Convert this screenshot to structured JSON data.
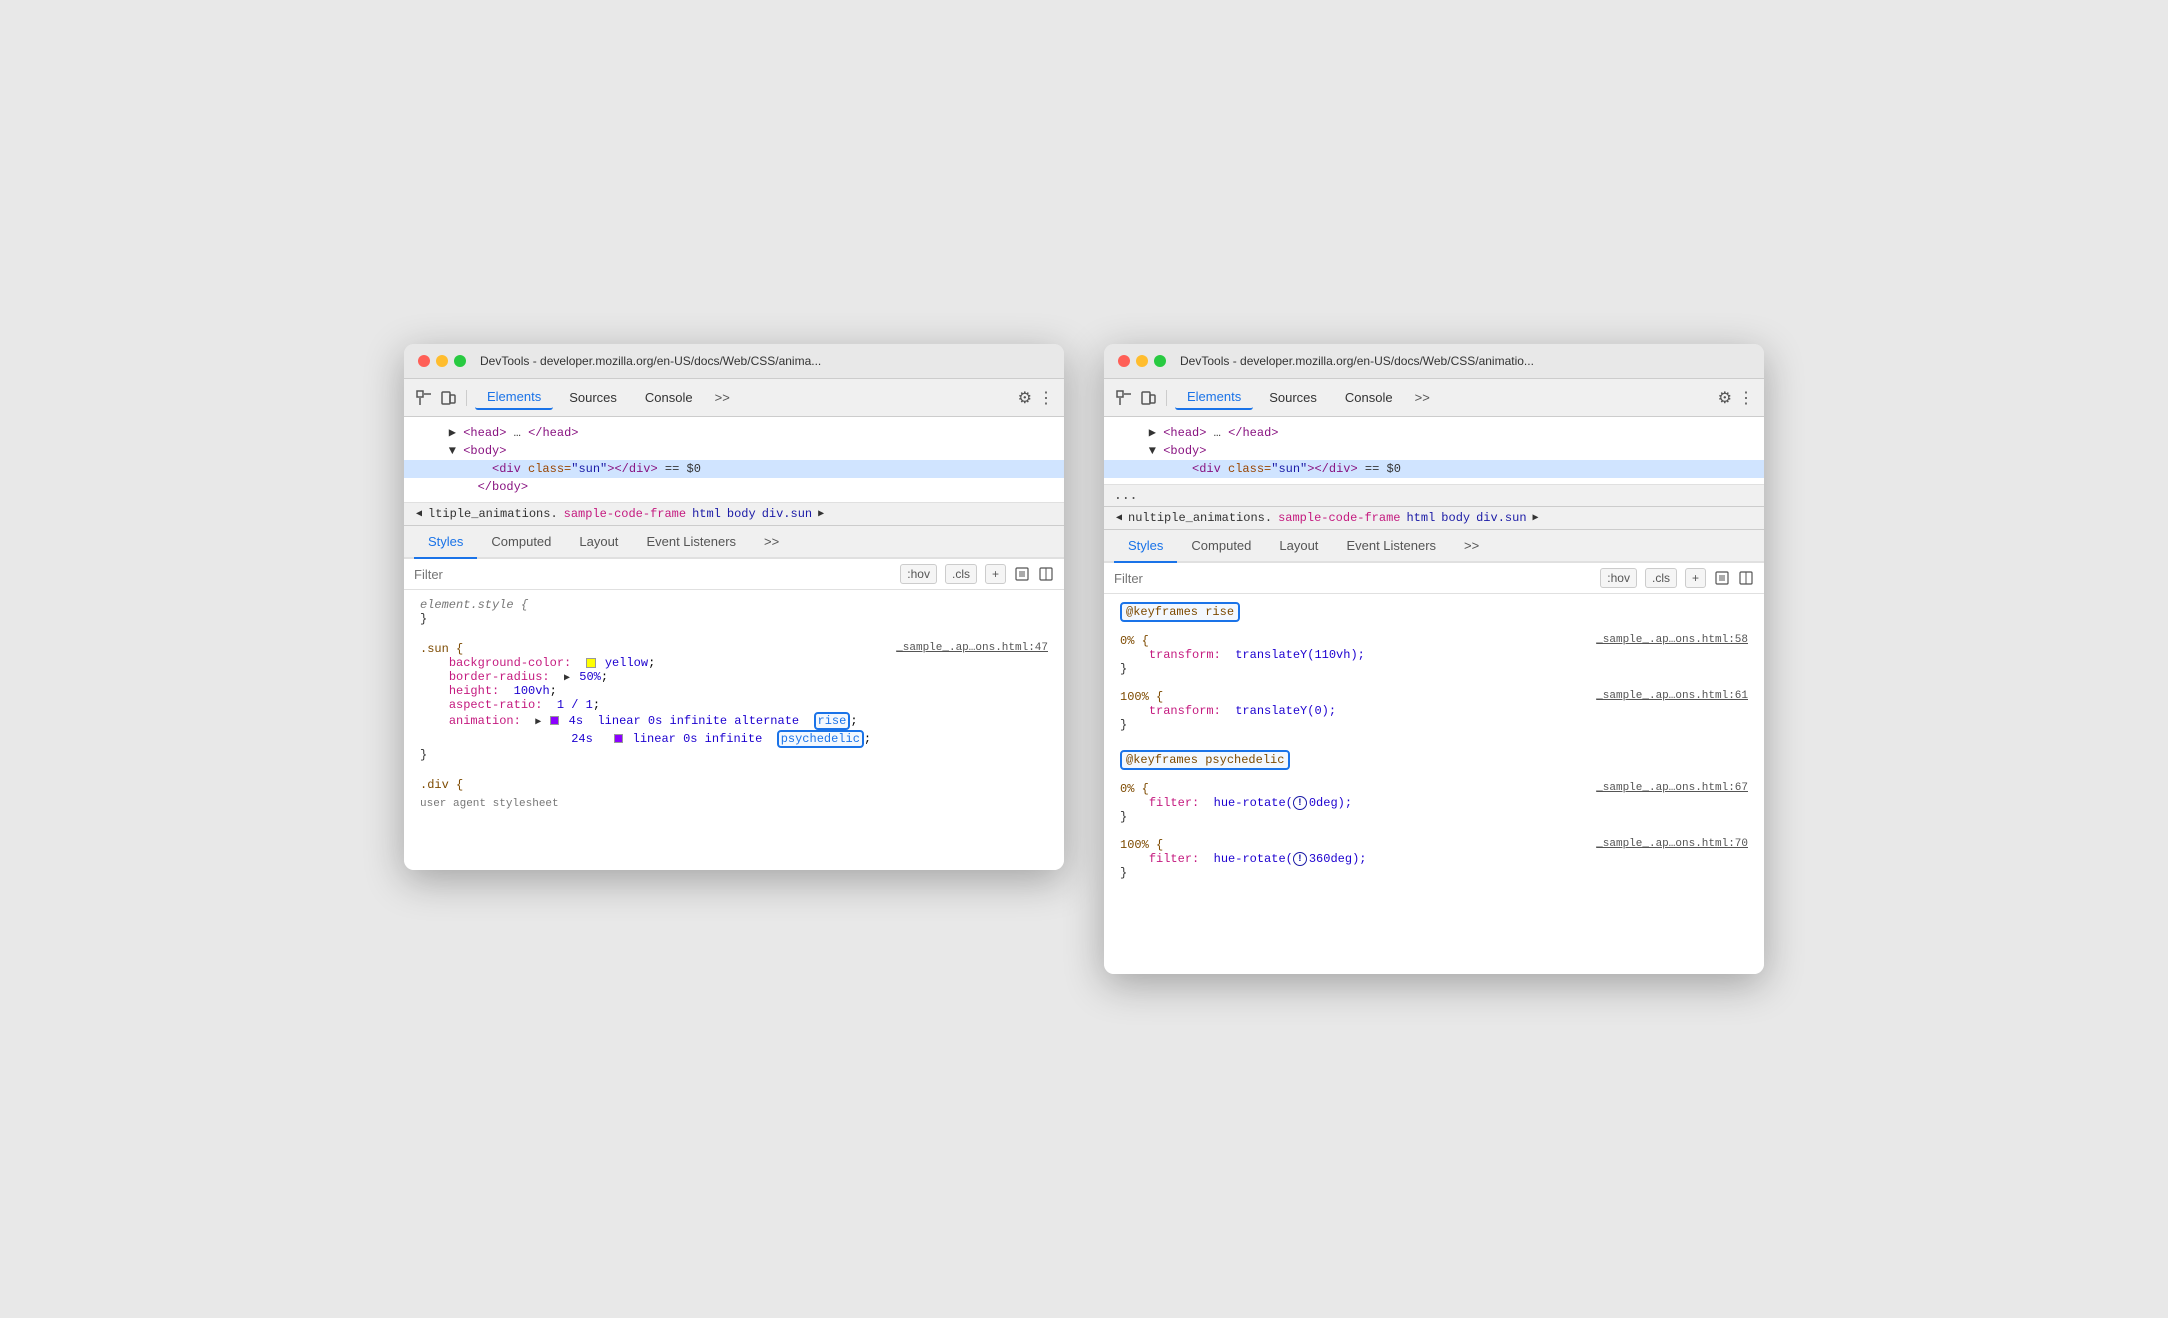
{
  "left_window": {
    "title": "DevTools - developer.mozilla.org/en-US/docs/Web/CSS/anima...",
    "traffic_lights": [
      "red",
      "yellow",
      "green"
    ],
    "toolbar_tabs": [
      "Elements",
      "Sources",
      "Console"
    ],
    "toolbar_more": ">>",
    "dom_lines": [
      "<head> … </head>",
      "<body>",
      "<div class=\"sun\"></div>  == $0",
      "</body>"
    ],
    "breadcrumb": "◀ ltiple_animations.sample-code-frame  html  body  div.sun  ▶",
    "panel_tabs": [
      "Styles",
      "Computed",
      "Layout",
      "Event Listeners",
      ">>"
    ],
    "filter_placeholder": "Filter",
    "filter_btns": [
      ":hov",
      ".cls",
      "+"
    ],
    "css_rules": [
      {
        "selector": "element.style {",
        "close": "}",
        "props": []
      },
      {
        "selector": ".sun {",
        "source": "_sample_.ap…ons.html:47",
        "close": "}",
        "props": [
          {
            "name": "background-color:",
            "value": "yellow",
            "has_swatch": true,
            "swatch_color": "#ffff00"
          },
          {
            "name": "border-radius:",
            "value": "▶ 50%;"
          },
          {
            "name": "height:",
            "value": "100vh;"
          },
          {
            "name": "aspect-ratio:",
            "value": "1 / 1;"
          },
          {
            "name": "animation:",
            "value": "▶ 4s  linear 0s infinite alternate  rise",
            "highlighted": "rise"
          },
          {
            "name": "",
            "value": "24s  linear 0s infinite  psychedelic",
            "highlighted": "psychedelic",
            "is_continuation": true
          }
        ]
      }
    ],
    "sub_text": ".div {"
  },
  "right_window": {
    "title": "DevTools - developer.mozilla.org/en-US/docs/Web/CSS/animatio...",
    "traffic_lights": [
      "red",
      "yellow",
      "green"
    ],
    "toolbar_tabs": [
      "Elements",
      "Sources",
      "Console"
    ],
    "toolbar_more": ">>",
    "dom_lines": [
      "<head> … </head>",
      "<body>",
      "<div class=\"sun\"></div>  == $0"
    ],
    "dots": "...",
    "breadcrumb": "◀ nultiple_animations.sample-code-frame  html  body  div.sun  ▶",
    "panel_tabs": [
      "Styles",
      "Computed",
      "Layout",
      "Event Listeners",
      ">>"
    ],
    "filter_placeholder": "Filter",
    "filter_btns": [
      ":hov",
      ".cls",
      "+"
    ],
    "css_sections": [
      {
        "selector": "@keyframes rise",
        "highlighted": true,
        "rules": [
          {
            "percent": "0% {",
            "source": "_sample_.ap…ons.html:58",
            "props": [
              {
                "name": "transform:",
                "value": "translateY(110vh);"
              }
            ],
            "close": "}"
          },
          {
            "percent": "100% {",
            "source": "_sample_.ap…ons.html:61",
            "props": [
              {
                "name": "transform:",
                "value": "translateY(0);"
              }
            ],
            "close": "}"
          }
        ]
      },
      {
        "selector": "@keyframes psychedelic",
        "highlighted": true,
        "rules": [
          {
            "percent": "0% {",
            "source": "_sample_.ap…ons.html:67",
            "props": [
              {
                "name": "filter:",
                "value": "hue-rotate(",
                "extra": "0deg);",
                "has_warning": true
              }
            ],
            "close": "}"
          },
          {
            "percent": "100% {",
            "source": "_sample_.ap…ons.html:70",
            "props": [
              {
                "name": "filter:",
                "value": "hue-rotate(",
                "extra": "360deg);",
                "has_warning": true
              }
            ],
            "close": "}"
          }
        ]
      }
    ]
  },
  "icons": {
    "inspect": "⬚",
    "device": "⬚",
    "gear": "⚙",
    "more": "⋮",
    "filter_icon_1": "⬚",
    "filter_icon_2": "⬚"
  }
}
